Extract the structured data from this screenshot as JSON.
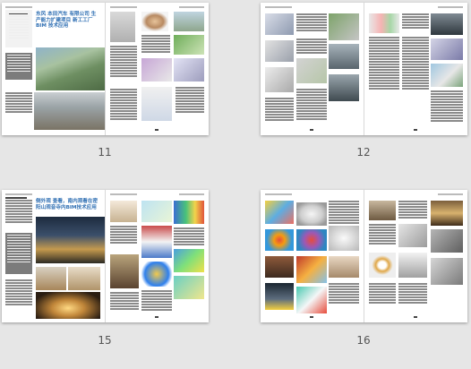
{
  "spreads": [
    {
      "label": "11",
      "title": "东风 本田汽车 有限公司 生产能力扩建项目 新工工厂 BIM 技术应用"
    },
    {
      "label": "12"
    },
    {
      "label": "15",
      "title": "侧外观 查看，南内观看在密阳山观音寺内BIM技术应用"
    },
    {
      "label": "16"
    }
  ],
  "colors": {
    "background": "#e6e6e6",
    "title_blue": "#2f6fb3"
  }
}
